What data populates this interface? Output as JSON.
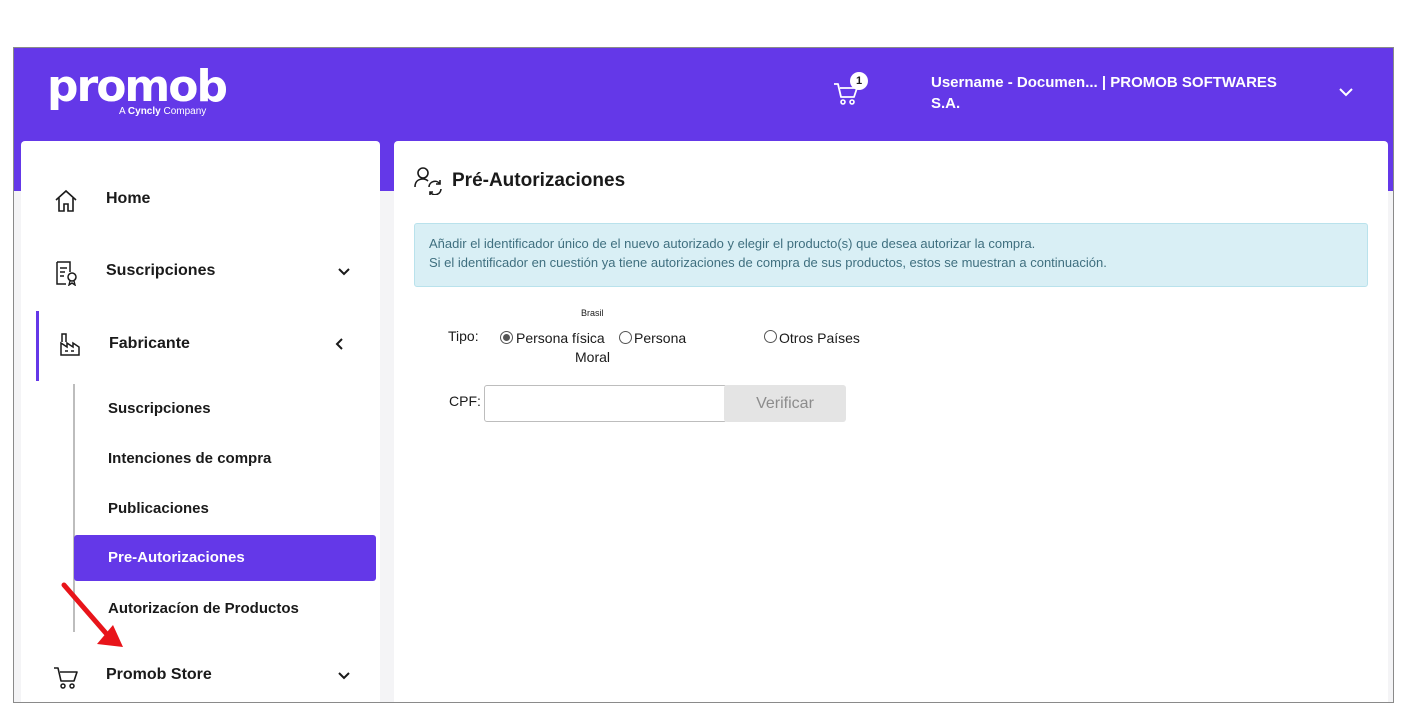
{
  "header": {
    "logo_text": "promob",
    "logo_tag_prefix": "A ",
    "logo_tag_brand": "Cyncly",
    "logo_tag_suffix": " Company",
    "cart_count": "1",
    "user_line1": "Username - Documen... | PROMOB SOFTWARES",
    "user_line2": "S.A."
  },
  "sidebar": {
    "items": [
      {
        "label": "Home",
        "icon": "home-icon"
      },
      {
        "label": "Suscripciones",
        "icon": "document-certificate-icon"
      },
      {
        "label": "Fabricante",
        "icon": "factory-icon"
      },
      {
        "label": "Promob Store",
        "icon": "cart-icon"
      }
    ],
    "subitems": [
      {
        "label": "Suscripciones"
      },
      {
        "label": "Intenciones de compra"
      },
      {
        "label": "Publicaciones"
      },
      {
        "label": "Pre-Autorizaciones"
      },
      {
        "label": "Autorizacíon de Productos"
      }
    ]
  },
  "main": {
    "title": "Pré-Autorizaciones",
    "alert_line1": "Añadir el identificador único de el nuevo autorizado y elegir el producto(s) que desea autorizar la compra.",
    "alert_line2": "Si el identificador en cuestión ya tiene autorizaciones de compra de sus productos, estos se muestran a continuación.",
    "tipo_label": "Tipo:",
    "brasil_label": "Brasil",
    "radio_persona_fisica": "Persona física",
    "radio_persona_moral_1": "Persona",
    "radio_persona_moral_2": "Moral",
    "radio_otros_paises": "Otros Países",
    "cpf_label": "CPF:",
    "cpf_value": "",
    "verify_label": "Verificar"
  },
  "colors": {
    "brand": "#6438e8",
    "alert_bg": "#d9eff5",
    "alert_text": "#3f6f7f",
    "annotation_arrow": "#e8141a"
  }
}
